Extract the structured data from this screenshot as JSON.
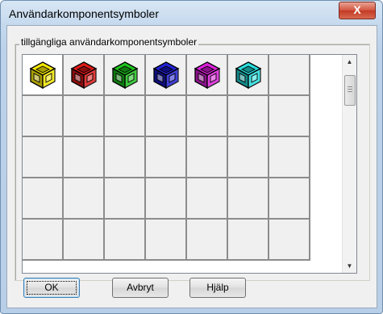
{
  "window": {
    "title": "Användarkomponentsymboler",
    "close_glyph": "X"
  },
  "group": {
    "label": "tillgängliga användarkomponentsymboler"
  },
  "symbols": [
    {
      "name": "yellow",
      "color": "#f2e600",
      "dark": "#a89e00"
    },
    {
      "name": "red",
      "color": "#e01a1a",
      "dark": "#8a0d0d"
    },
    {
      "name": "green",
      "color": "#1fc41f",
      "dark": "#0f7a0f"
    },
    {
      "name": "blue",
      "color": "#2222d6",
      "dark": "#0e0e7e"
    },
    {
      "name": "magenta",
      "color": "#dd22dd",
      "dark": "#8a138a"
    },
    {
      "name": "cyan",
      "color": "#29e0e0",
      "dark": "#148a8a"
    }
  ],
  "grid": {
    "columns": 7,
    "rows": 5,
    "selected_index": 0
  },
  "buttons": {
    "ok": "OK",
    "cancel": "Avbryt",
    "help": "Hjälp"
  }
}
